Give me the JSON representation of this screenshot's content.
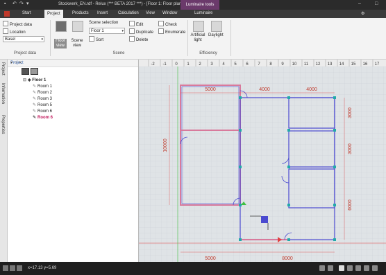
{
  "window": {
    "title": "Stockwerk_EN.rdf - Relux (*** BETA 2017 ***) - [Floor 1: Floor plan]",
    "context_tab": "Luminaire tools"
  },
  "menu": {
    "items": [
      "Start",
      "Project",
      "Products",
      "Insert",
      "Calculation",
      "View",
      "Window",
      "Luminaire"
    ],
    "active": "Project"
  },
  "ribbon": {
    "project_data": {
      "project_data_label": "Project data",
      "location_label": "Location",
      "location_value": "Basel",
      "group_label": "Project data"
    },
    "scene": {
      "floor_view_label": "Floor view",
      "scene_view_label": "Scene view",
      "scene_selection_label": "Scene selection",
      "scene_selection_value": "Floor 1",
      "sort_label": "Sort",
      "edit_label": "Edit",
      "duplicate_label": "Duplicate",
      "delete_label": "Delete",
      "check_label": "Check",
      "enumerate_label": "Enumerate",
      "group_label": "Scene"
    },
    "efficiency": {
      "artificial_light_label": "Artificial light",
      "daylight_label": "Daylight",
      "group_label": "Efficiency"
    }
  },
  "side_tabs": [
    "Project",
    "Information",
    "Properties"
  ],
  "project_panel": {
    "title": "Project",
    "tree": {
      "floor": "Floor 1",
      "rooms": [
        "Room 1",
        "Room 2",
        "Room 3",
        "Room 5",
        "Room 6",
        "Room 6"
      ],
      "selected_index": 5
    }
  },
  "ruler": {
    "x_ticks": [
      "-2",
      "-1",
      "0",
      "1",
      "2",
      "3",
      "4",
      "5",
      "6",
      "7",
      "8",
      "9",
      "10",
      "11",
      "12",
      "13",
      "14",
      "15",
      "16",
      "17"
    ]
  },
  "plan": {
    "dimensions_top": [
      "5000",
      "4000",
      "4000"
    ],
    "dimensions_bottom": [
      "5000",
      "8000"
    ],
    "dimension_left": "10000",
    "dimensions_right": [
      "3000",
      "3000",
      "6000"
    ]
  },
  "status": {
    "coordinates": "x=17.13 y=5.69"
  },
  "colors": {
    "accent_pink": "#c2185b",
    "wall_pink": "#d87a9c",
    "wall_blue": "#4a4ad0",
    "grid": "#c9d0d6",
    "axis_red": "#e04040",
    "axis_green": "#40c040",
    "context_tab": "#6b3a6b"
  }
}
